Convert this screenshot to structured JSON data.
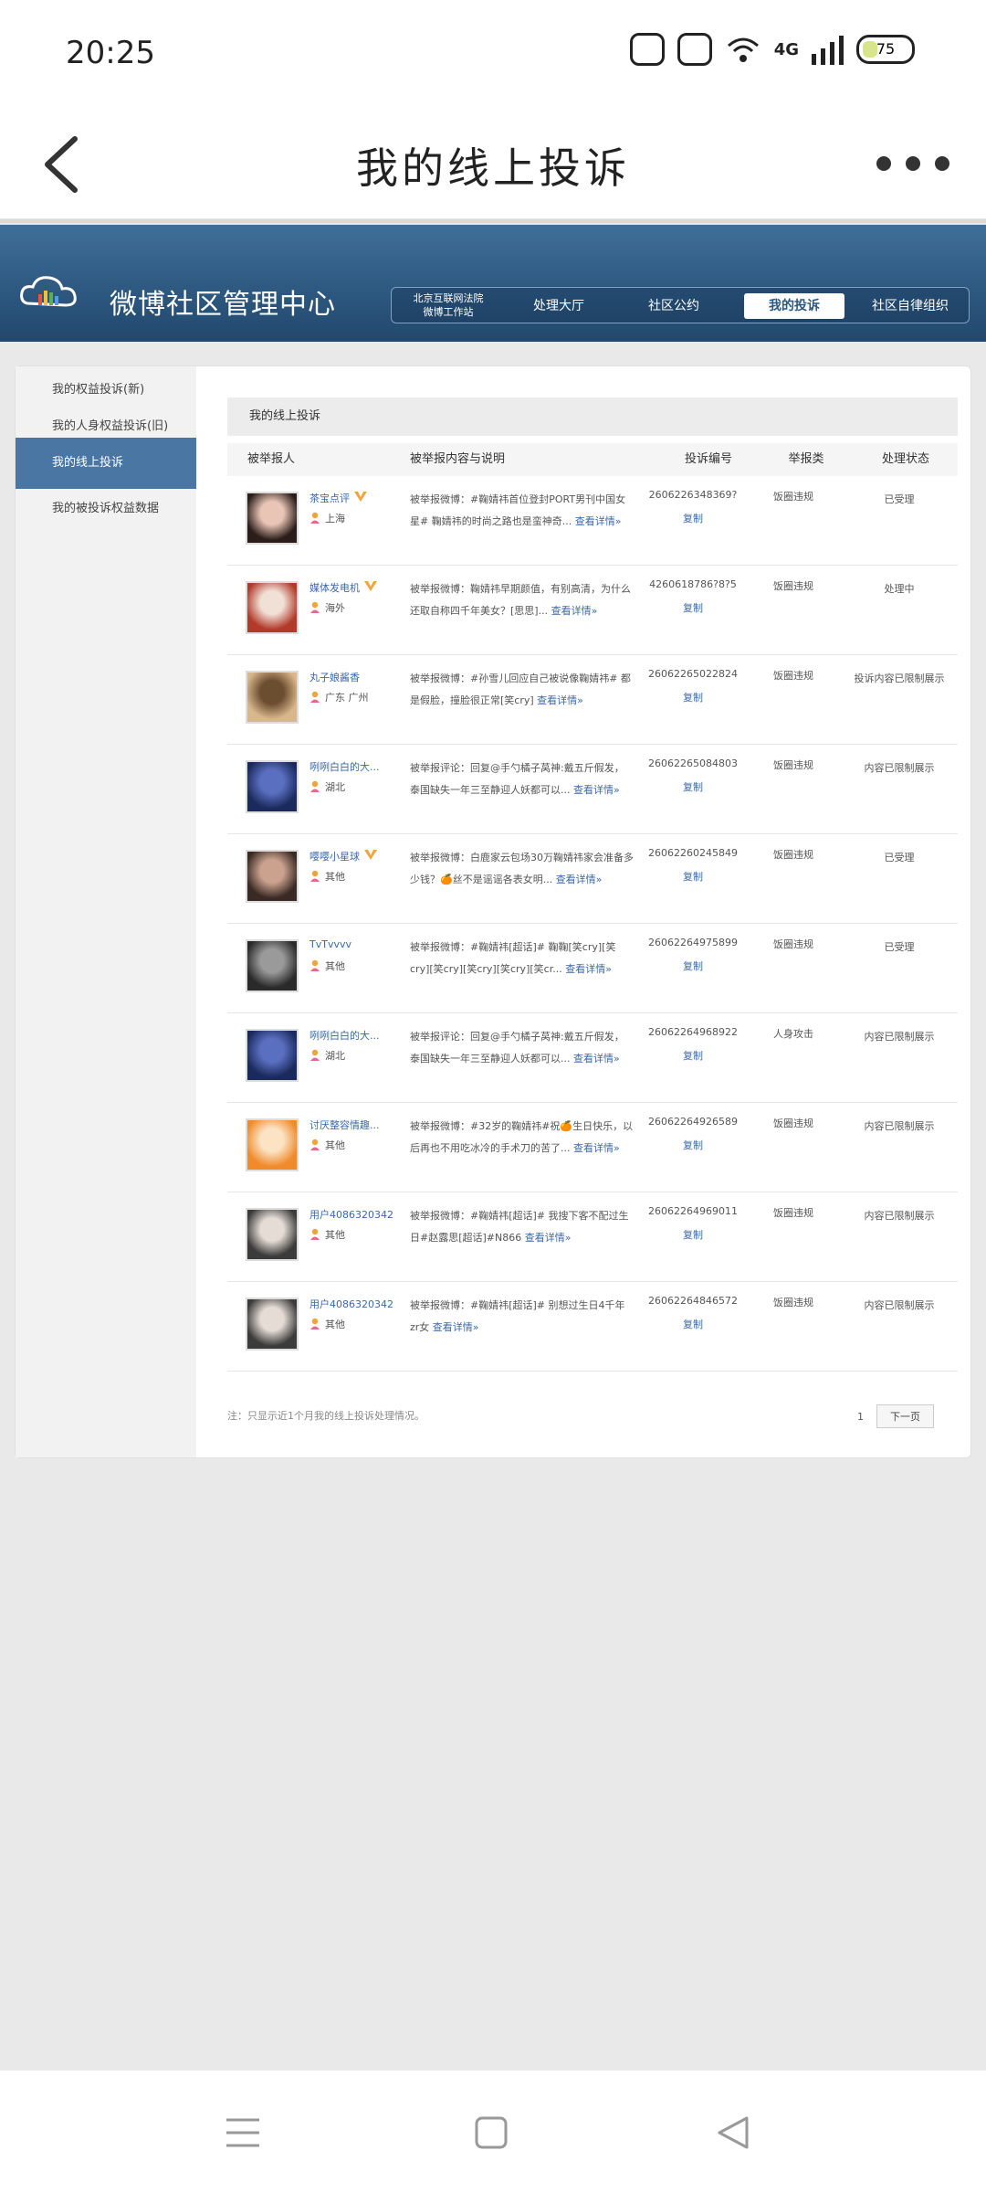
{
  "status_bar": {
    "time": "20:25",
    "network": "4G",
    "battery": "75"
  },
  "header": {
    "title": "我的线上投诉"
  },
  "site": {
    "brand": "微博社区管理中心",
    "court_label_line1": "北京互联网法院",
    "court_label_line2": "微博工作站",
    "nav": [
      "处理大厅",
      "社区公约",
      "我的投诉",
      "社区自律组织"
    ],
    "active_nav_index": 2
  },
  "sidebar": {
    "items": [
      "我的权益投诉(新)",
      "我的人身权益投诉(旧)",
      "我的线上投诉",
      "我的被投诉权益数据"
    ],
    "active_index": 2
  },
  "main": {
    "title": "我的线上投诉",
    "columns": [
      "被举报人",
      "被举报内容与说明",
      "投诉编号",
      "举报类",
      "处理状态"
    ],
    "copy_label": "复制",
    "more_label": "查看详情»",
    "rows": [
      {
        "name": "茶宝点评",
        "vip": true,
        "location": "上海",
        "content": "被举报微博：#鞠婧祎首位登封PORT男刊中国女星# 鞠婧祎的时尚之路也是蛮神奇...",
        "id": "2606226348369?",
        "category": "饭圈违规",
        "status": "已受理"
      },
      {
        "name": "媒体发电机",
        "vip": true,
        "location": "海外",
        "content": "被举报微博：鞠婧祎早期颜值，有别高清，为什么还取自称四千年美女？[思思]...",
        "id": "4260618786?8?5",
        "category": "饭圈违规",
        "status": "处理中"
      },
      {
        "name": "丸子娘酱香",
        "vip": false,
        "location": "广东 广州",
        "content": "被举报微博：#孙雪儿回应自己被说像鞠婧祎# 都是假脸，撞脸很正常[笑cry]",
        "id": "26062265022824",
        "category": "饭圈违规",
        "status": "投诉内容已限制展示"
      },
      {
        "name": "咧咧白白的大...",
        "vip": false,
        "location": "湖北",
        "content": "被举报评论：回复@手勺橘子莴神:戴五斤假发，泰国缺失一年三至静迎人妖都可以...",
        "id": "26062265084803",
        "category": "饭圈违规",
        "status": "内容已限制展示"
      },
      {
        "name": "嘤嘤小星球",
        "vip": true,
        "location": "其他",
        "content": "被举报微博：白鹿家云包场30万鞠婧祎家会准备多少钱？🍊丝不是谣谣各表女明...",
        "id": "26062260245849",
        "category": "饭圈违规",
        "status": "已受理"
      },
      {
        "name": "TvTvvvv",
        "vip": false,
        "location": "其他",
        "content": "被举报微博：#鞠婧祎[超话]# 鞠鞠[笑cry][笑cry][笑cry][笑cry][笑cry][笑cr...",
        "id": "26062264975899",
        "category": "饭圈违规",
        "status": "已受理"
      },
      {
        "name": "咧咧白白的大...",
        "vip": false,
        "location": "湖北",
        "content": "被举报评论：回复@手勺橘子莴神:戴五斤假发，泰国缺失一年三至静迎人妖都可以...",
        "id": "26062264968922",
        "category": "人身攻击",
        "status": "内容已限制展示"
      },
      {
        "name": "讨厌整容情趣...",
        "vip": false,
        "location": "其他",
        "content": "被举报微博：#32岁的鞠婧祎#祝🍊生日快乐，以后再也不用吃冰冷的手术刀的苦了...",
        "id": "26062264926589",
        "category": "饭圈违规",
        "status": "内容已限制展示"
      },
      {
        "name": "用户4086320342",
        "vip": false,
        "location": "其他",
        "content": "被举报微博：#鞠婧祎[超话]# 我搜下客不配过生日#赵露思[超话]#N866",
        "id": "26062264969011",
        "category": "饭圈违规",
        "status": "内容已限制展示"
      },
      {
        "name": "用户4086320342",
        "vip": false,
        "location": "其他",
        "content": "被举报微博：#鞠婧祎[超话]# 别想过生日4千年zr女",
        "id": "26062264846572",
        "category": "饭圈违规",
        "status": "内容已限制展示"
      }
    ]
  },
  "footer": {
    "note": "注：只显示近1个月我的线上投诉处理情况。",
    "page": "1",
    "next": "下一页"
  },
  "colors": {
    "banner": "#2c577f",
    "sidebar_active": "#4a76a3",
    "link": "#3c69a6"
  }
}
